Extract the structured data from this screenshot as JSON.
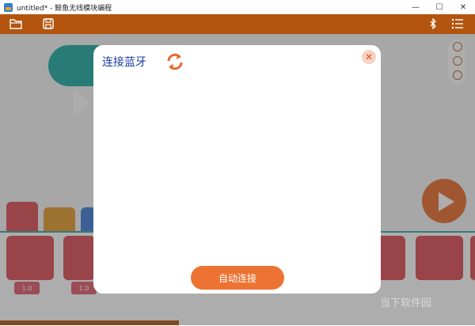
{
  "window": {
    "title": "untitled* - 鲸鱼无线模块编程",
    "min": "—",
    "max": "☐",
    "close": "✕"
  },
  "toolbar": {
    "open_icon": "folder-icon",
    "save_icon": "save-icon",
    "bt_icon": "bluetooth-icon",
    "menu_icon": "menu-icon"
  },
  "values": [
    "1.0",
    "1.0"
  ],
  "modal": {
    "title": "连接蓝牙",
    "close": "✕",
    "auto_connect": "自动连接"
  },
  "watermark": "当下软件园",
  "colors": {
    "toolbar": "#b3550e",
    "accent": "#ed7332",
    "block": "#dc4a52",
    "teal": "#1aa9a0",
    "title_blue": "#1b3fa0"
  }
}
